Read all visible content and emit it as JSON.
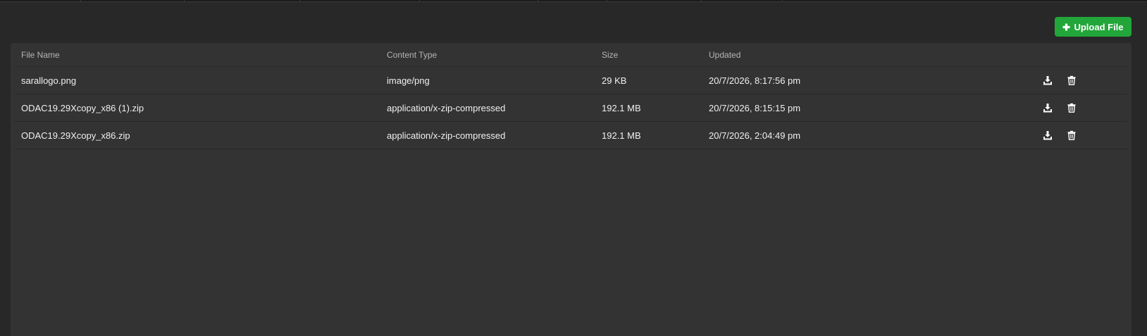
{
  "toolbar": {
    "upload_label": "Upload File",
    "upload_icon": "plus-icon",
    "accent_color": "#22a63a"
  },
  "table": {
    "columns": [
      "File Name",
      "Content Type",
      "Size",
      "Updated"
    ],
    "rows": [
      {
        "name": "sarallogo.png",
        "type": "image/png",
        "size": "29 KB",
        "updated": "20/7/2026, 8:17:56 pm"
      },
      {
        "name": "ODAC19.29Xcopy_x86 (1).zip",
        "type": "application/x-zip-compressed",
        "size": "192.1 MB",
        "updated": "20/7/2026, 8:15:15 pm"
      },
      {
        "name": "ODAC19.29Xcopy_x86.zip",
        "type": "application/x-zip-compressed",
        "size": "192.1 MB",
        "updated": "20/7/2026, 2:04:49 pm"
      }
    ],
    "row_actions": [
      "download-icon",
      "trash-icon"
    ]
  }
}
